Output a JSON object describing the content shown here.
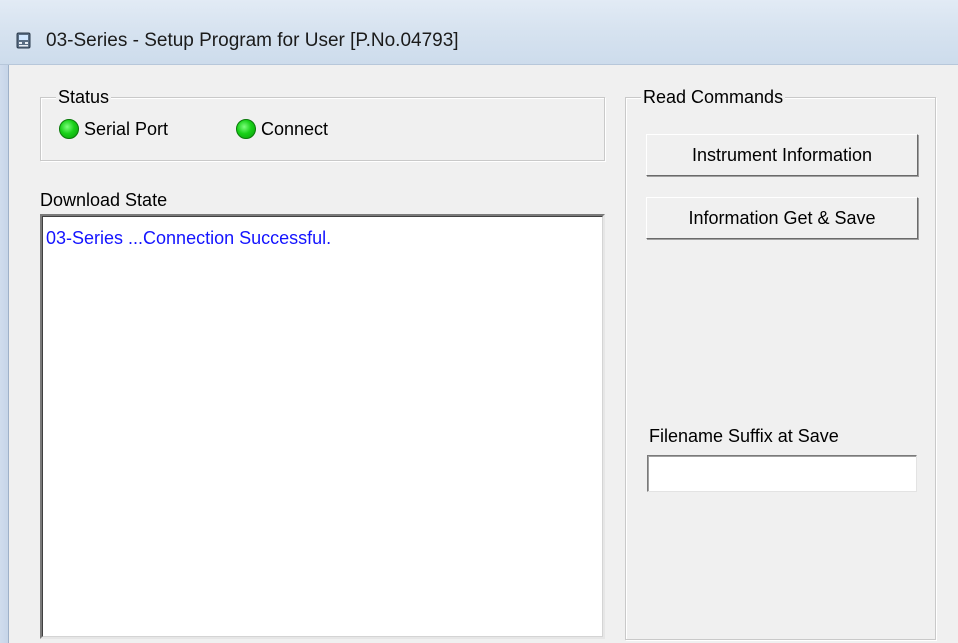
{
  "window": {
    "title": "03-Series - Setup Program for User [P.No.04793]",
    "icon": "instrument-app-icon"
  },
  "status": {
    "legend": "Status",
    "indicators": [
      {
        "label": "Serial Port",
        "state": "on",
        "color": "#18d018"
      },
      {
        "label": "Connect",
        "state": "on",
        "color": "#18d018"
      }
    ]
  },
  "download": {
    "label": "Download State",
    "log_lines": [
      "03-Series ...Connection Successful."
    ],
    "log_color": "#1414ff"
  },
  "read_commands": {
    "legend": "Read Commands",
    "instrument_info_label": "Instrument Information",
    "info_get_save_label": "Information Get & Save",
    "filename_suffix_label": "Filename Suffix at Save",
    "filename_suffix_value": ""
  }
}
